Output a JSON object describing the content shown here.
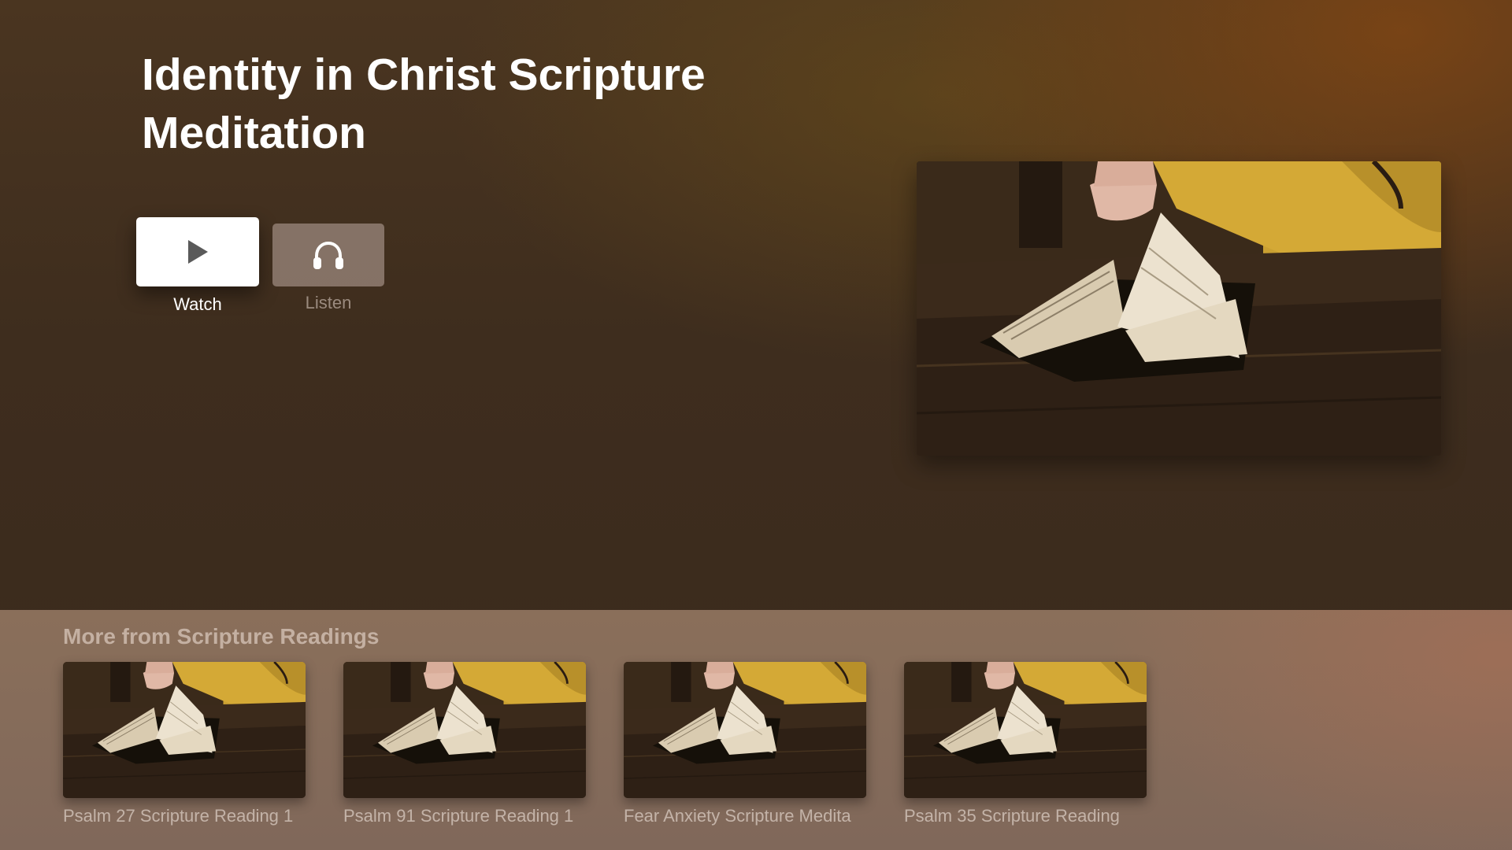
{
  "app": {
    "accent_color": "#ffffff",
    "background_color": "#3e2d1e"
  },
  "hero": {
    "title": "Identity in Christ Scripture Meditation",
    "artwork_icon": "open-bible-image"
  },
  "actions": {
    "watch": {
      "label": "Watch",
      "icon": "play-icon",
      "focused": true
    },
    "listen": {
      "label": "Listen",
      "icon": "headphones-icon",
      "focused": false
    }
  },
  "shelf": {
    "title": "More from Scripture Readings",
    "items": [
      {
        "title": "Psalm 27 Scripture Reading 1",
        "thumbnail_icon": "open-bible-image"
      },
      {
        "title": "Psalm 91 Scripture Reading 1",
        "thumbnail_icon": "open-bible-image"
      },
      {
        "title": "Fear Anxiety Scripture Medita",
        "thumbnail_icon": "open-bible-image"
      },
      {
        "title": "Psalm 35 Scripture Reading",
        "thumbnail_icon": "open-bible-image"
      }
    ]
  }
}
